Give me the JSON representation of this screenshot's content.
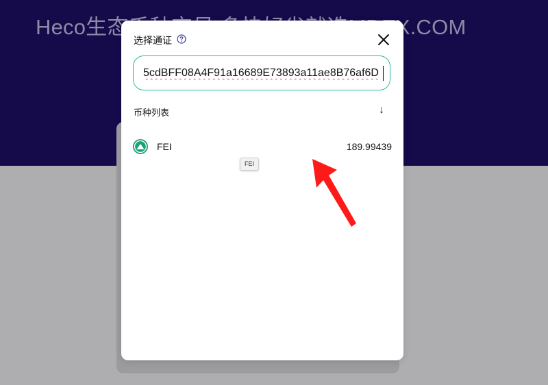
{
  "hero": {
    "title": "Heco生态千种交易 多快好省就选MDEX.COM"
  },
  "modal": {
    "title": "选择通证",
    "help_icon": "question-circle-icon",
    "close_icon": "close-icon",
    "search": {
      "value": "5cdBFF08A4F91a16689E73893a11ae8B76af6D",
      "placeholder": ""
    },
    "list_label": "币种列表",
    "sort_icon": "arrow-down-icon",
    "sort_glyph": "↓",
    "tokens": [
      {
        "symbol": "FEI",
        "balance": "189.99439",
        "logo_icon": "fei-logo-icon",
        "tooltip": "FEI"
      }
    ]
  },
  "colors": {
    "hero_bg": "#150a4a",
    "accent_border": "#2ab8a0",
    "token_logo": "#1aa37a",
    "annotation_arrow": "#ff1a1a"
  }
}
